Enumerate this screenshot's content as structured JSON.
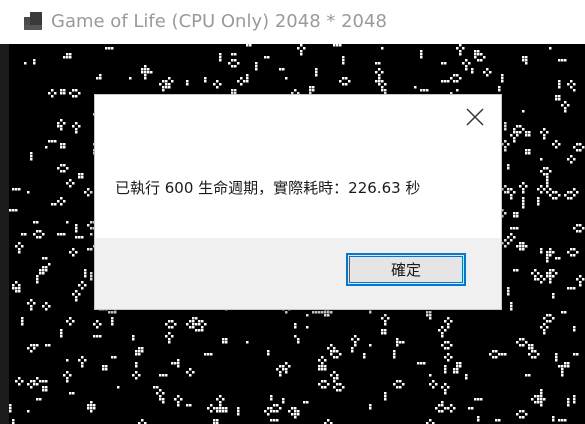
{
  "window": {
    "title": "Game of Life (CPU Only) 2048 * 2048",
    "icon": "app-grid-icon"
  },
  "canvas": {
    "description_icon": "game-of-life-grid"
  },
  "dialog": {
    "message": "已執行 600 生命週期，實際耗時：226.63 秒",
    "ok_label": "確定",
    "close_icon": "close-icon",
    "accent_color": "#0078d7"
  }
}
